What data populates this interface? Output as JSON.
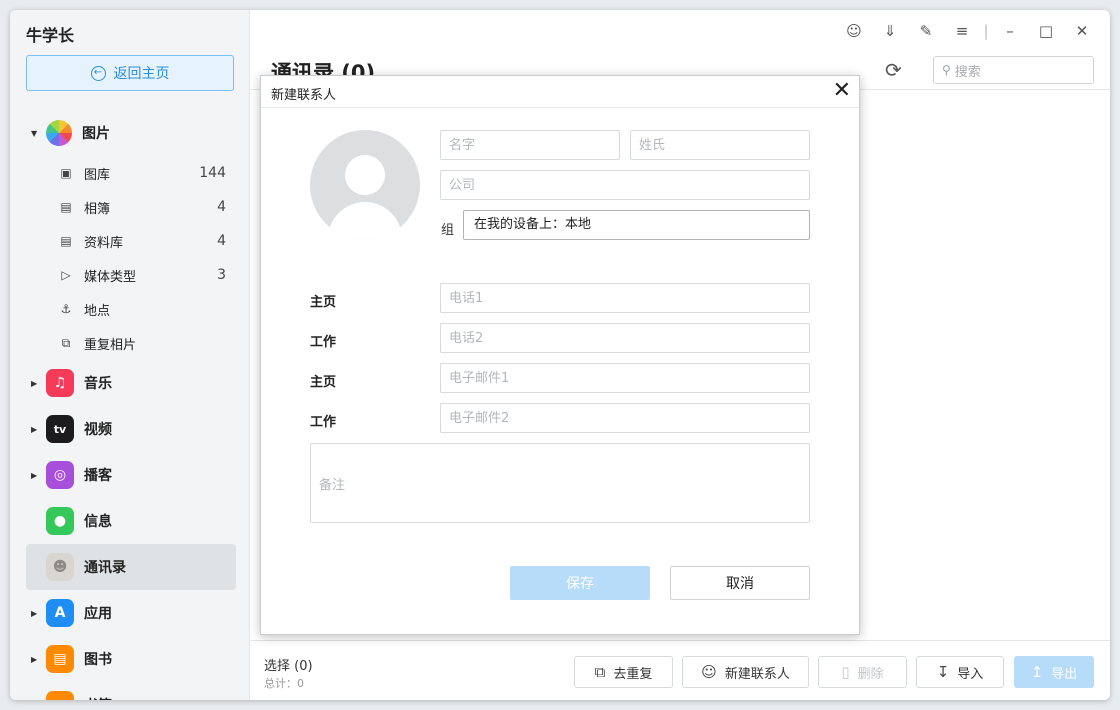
{
  "app": {
    "name": "牛学长",
    "back_label": "返回主页"
  },
  "sidebar": {
    "photos": {
      "label": "图片",
      "color": "#ffffff"
    },
    "photo_subs": [
      {
        "label": "图库",
        "count": "144",
        "icon": "photo-icon"
      },
      {
        "label": "相簿",
        "count": "4",
        "icon": "album-icon"
      },
      {
        "label": "资料库",
        "count": "4",
        "icon": "library-icon"
      },
      {
        "label": "媒体类型",
        "count": "3",
        "icon": "video-icon"
      },
      {
        "label": "地点",
        "count": "",
        "icon": "location-icon"
      },
      {
        "label": "重复相片",
        "count": "",
        "icon": "duplicate-photo-icon"
      }
    ],
    "categories": [
      {
        "label": "音乐",
        "icon": "music-icon",
        "color": "#f53b57"
      },
      {
        "label": "视频",
        "icon": "appletv-icon",
        "color": "#1c1c1e"
      },
      {
        "label": "播客",
        "icon": "podcast-icon",
        "color": "#a74fdb"
      },
      {
        "label": "信息",
        "icon": "message-icon",
        "color": "#34c759"
      },
      {
        "label": "通讯录",
        "icon": "contacts-icon",
        "color": "#d9d6d1"
      },
      {
        "label": "应用",
        "icon": "appstore-icon",
        "color": "#1e8ef5"
      },
      {
        "label": "图书",
        "icon": "books-icon",
        "color": "#ff8a00"
      },
      {
        "label": "书签",
        "icon": "bookmark-icon",
        "color": "#ff8a00"
      }
    ]
  },
  "main": {
    "title": "通讯录 (0)",
    "search_placeholder": "搜索"
  },
  "footer": {
    "selected": "选择  (0)",
    "total": "总计：0",
    "dedupe": "去重复",
    "new_contact": "新建联系人",
    "delete": "删除",
    "import": "导入",
    "export": "导出"
  },
  "modal": {
    "title": "新建联系人",
    "first_name_ph": "名字",
    "last_name_ph": "姓氏",
    "company_ph": "公司",
    "group_label": "组",
    "group_value": "在我的设备上：本地",
    "phone_rows": [
      {
        "label": "主页",
        "placeholder": "电话1"
      },
      {
        "label": "工作",
        "placeholder": "电话2"
      },
      {
        "label": "主页",
        "placeholder": "电子邮件1"
      },
      {
        "label": "工作",
        "placeholder": "电子邮件2"
      }
    ],
    "notes_ph": "备注",
    "save_label": "保存",
    "cancel_label": "取消"
  }
}
